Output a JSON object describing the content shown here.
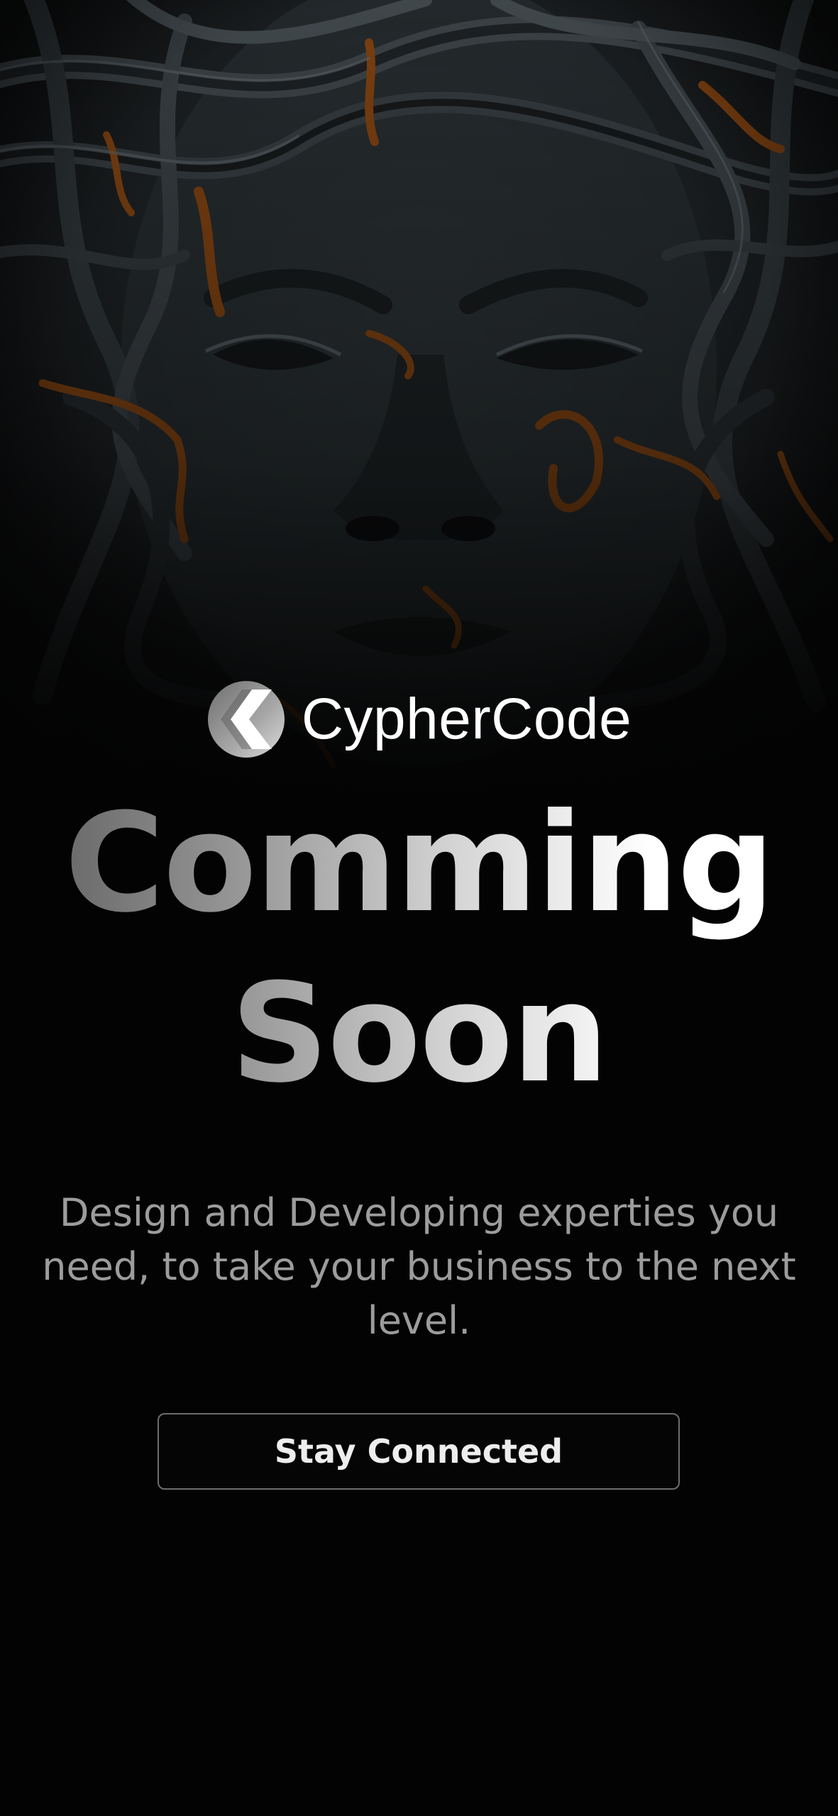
{
  "brand": {
    "name": "CypherCode",
    "logo_icon": "cyphercode-logo-icon"
  },
  "hero": {
    "illustration": "dark-sculpted-face-with-tangled-cables"
  },
  "headline": {
    "line1": "Comming",
    "line2": "Soon"
  },
  "description": "Design and Developing experties you need, to take your business to the next level.",
  "cta": {
    "label": "Stay Connected"
  },
  "colors": {
    "background": "#030303",
    "text_primary": "#ffffff",
    "text_secondary": "#9c9c9c",
    "cable_accent": "#8a4a12",
    "button_border": "#6d6d6d"
  }
}
